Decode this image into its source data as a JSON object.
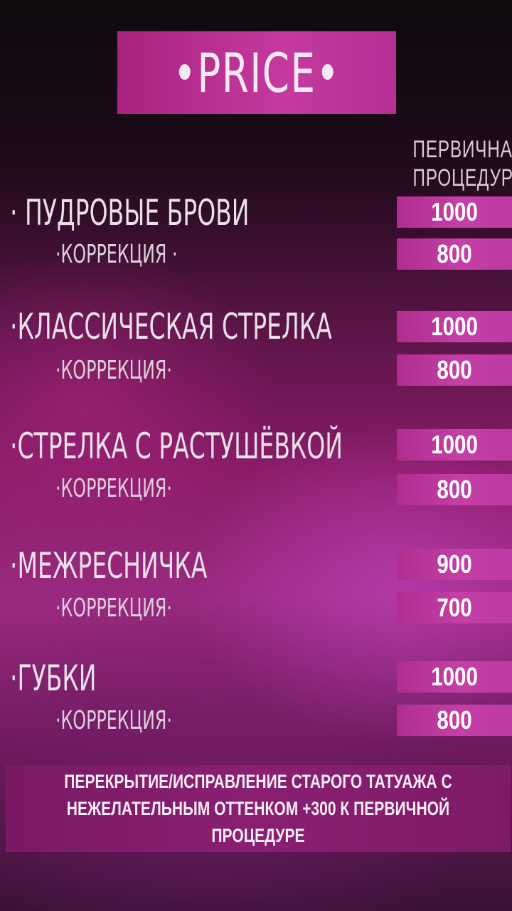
{
  "title": "•PRICE•",
  "column_header": [
    "ПЕРВИЧНАЯ",
    "ПРОЦЕДУРА"
  ],
  "services": [
    {
      "name": "· ПУДРОВЫЕ БРОВИ",
      "price": "1000",
      "correction_label": "·КОРРЕКЦИЯ ·",
      "correction_price": "800"
    },
    {
      "name": "·КЛАССИЧЕСКАЯ СТРЕЛКА",
      "price": "1000",
      "correction_label": "·КОРРЕКЦИЯ·",
      "correction_price": "800"
    },
    {
      "name": "·СТРЕЛКА С РАСТУШЁВКОЙ",
      "price": "1000",
      "correction_label": "·КОРРЕКЦИЯ·",
      "correction_price": "800"
    },
    {
      "name": "·МЕЖРЕСНИЧКА",
      "price": "900",
      "correction_label": "·КОРРЕКЦИЯ·",
      "correction_price": "700"
    },
    {
      "name": "·ГУБКИ",
      "price": "1000",
      "correction_label": "·КОРРЕКЦИЯ·",
      "correction_price": "800"
    }
  ],
  "note": "ПЕРЕКРЫТИЕ/ИСПРАВЛЕНИЕ СТАРОГО ТАТУАЖА С НЕЖЕЛАТЕЛЬНЫМ ОТТЕНКОМ +300 К ПЕРВИЧНОЙ ПРОЦЕДУРЕ",
  "colors": {
    "accent": "#c43aa0",
    "background_dark": "#0e0a0d",
    "background_mid": "#8a1c68"
  }
}
